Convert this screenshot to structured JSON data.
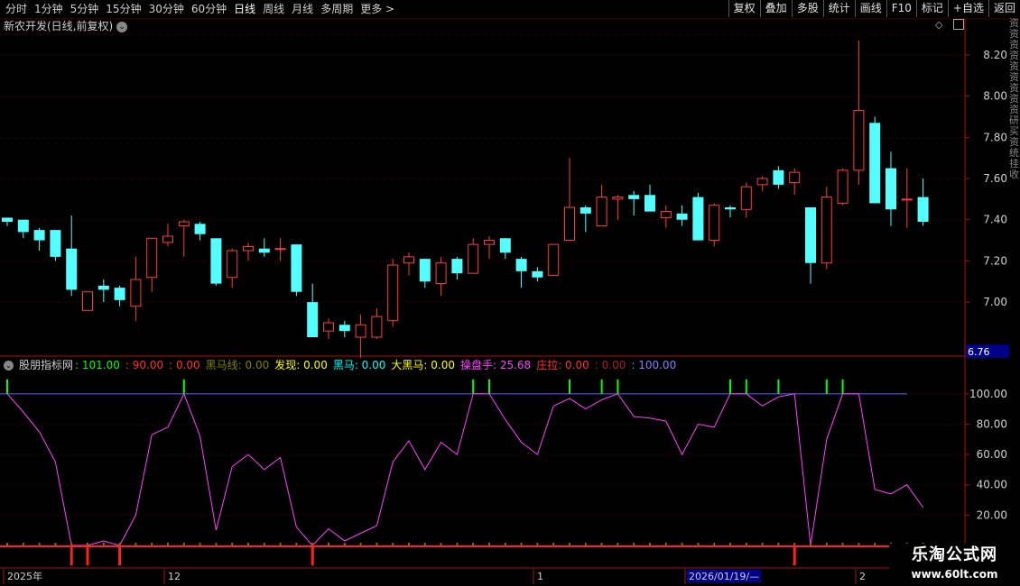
{
  "toolbar": {
    "periods": [
      "分时",
      "1分钟",
      "5分钟",
      "15分钟",
      "30分钟",
      "60分钟",
      "日线",
      "周线",
      "月线",
      "多周期",
      "更多 >"
    ],
    "active_period": "日线",
    "tools": [
      "复权",
      "叠加",
      "多股",
      "统计",
      "画线",
      "F10",
      "标记",
      "+自选",
      "返回"
    ]
  },
  "stock": {
    "title": "新农开发(日线,前复权)"
  },
  "price_axis": {
    "ticks": [
      "8.20",
      "8.00",
      "7.80",
      "7.60",
      "7.40",
      "7.20",
      "7.00"
    ],
    "marker": "6.76"
  },
  "right_strip": {
    "text": "资资资资资资资资资研买资统挂收"
  },
  "indicator": {
    "name": "股朋指标网",
    "items": [
      {
        "label": ": 101.00",
        "color": "#00ff00"
      },
      {
        "label": ": 90.00",
        "color": "#ff3030"
      },
      {
        "label": ": 0.00",
        "color": "#ff3030"
      },
      {
        "label": "黑马线: 0.00",
        "color": "#808000"
      },
      {
        "label": "发现: 0.00",
        "color": "#ffff00"
      },
      {
        "label": "黑马: 0.00",
        "color": "#00ffff"
      },
      {
        "label": "大黑马: 0.00",
        "color": "#ffff00"
      },
      {
        "label": "操盘手: 25.68",
        "color": "#ff40ff"
      },
      {
        "label": "庄拉: 0.00",
        "color": "#ff3030"
      },
      {
        "label": ": 0.00",
        "color": "#aa2020"
      },
      {
        "label": ": 100.00",
        "color": "#8080ff"
      }
    ],
    "ticks": [
      "100.00",
      "80.00",
      "60.00",
      "40.00",
      "20.00"
    ]
  },
  "time_axis": {
    "labels": [
      "2025年",
      "12",
      "1",
      "2026/01/19/—",
      "2"
    ]
  },
  "watermark": {
    "line1": "乐淘公式网",
    "line2": "www.60lt.com"
  },
  "colors": {
    "up": "#ff3c3c",
    "down": "#54ffff",
    "grid": "#5a0000",
    "ref_line": "#6060ff",
    "line": "#ff40ff"
  },
  "chart_data": [
    {
      "type": "candlestick",
      "title": "新农开发(日线,前复权)",
      "ylim": [
        6.76,
        8.3
      ],
      "candles": [
        {
          "o": 7.41,
          "c": 7.39,
          "h": 7.41,
          "l": 7.37
        },
        {
          "o": 7.4,
          "c": 7.34,
          "h": 7.4,
          "l": 7.31
        },
        {
          "o": 7.35,
          "c": 7.3,
          "h": 7.36,
          "l": 7.25
        },
        {
          "o": 7.35,
          "c": 7.22,
          "h": 7.35,
          "l": 7.2
        },
        {
          "o": 7.26,
          "c": 7.06,
          "h": 7.42,
          "l": 7.03
        },
        {
          "o": 6.96,
          "c": 7.05,
          "h": 7.05,
          "l": 6.96
        },
        {
          "o": 7.08,
          "c": 7.06,
          "h": 7.11,
          "l": 7.0
        },
        {
          "o": 7.07,
          "c": 7.01,
          "h": 7.08,
          "l": 6.98
        },
        {
          "o": 6.98,
          "c": 7.11,
          "h": 7.22,
          "l": 6.91
        },
        {
          "o": 7.12,
          "c": 7.31,
          "h": 7.31,
          "l": 7.05
        },
        {
          "o": 7.29,
          "c": 7.32,
          "h": 7.38,
          "l": 7.27
        },
        {
          "o": 7.37,
          "c": 7.39,
          "h": 7.4,
          "l": 7.22
        },
        {
          "o": 7.38,
          "c": 7.33,
          "h": 7.39,
          "l": 7.3
        },
        {
          "o": 7.31,
          "c": 7.09,
          "h": 7.31,
          "l": 7.08
        },
        {
          "o": 7.12,
          "c": 7.25,
          "h": 7.26,
          "l": 7.07
        },
        {
          "o": 7.25,
          "c": 7.27,
          "h": 7.29,
          "l": 7.2
        },
        {
          "o": 7.26,
          "c": 7.24,
          "h": 7.31,
          "l": 7.22
        },
        {
          "o": 7.26,
          "c": 7.26,
          "h": 7.31,
          "l": 7.2
        },
        {
          "o": 7.28,
          "c": 7.05,
          "h": 7.28,
          "l": 7.03
        },
        {
          "o": 7.0,
          "c": 6.83,
          "h": 7.09,
          "l": 6.83
        },
        {
          "o": 6.86,
          "c": 6.9,
          "h": 6.92,
          "l": 6.82
        },
        {
          "o": 6.89,
          "c": 6.86,
          "h": 6.91,
          "l": 6.83
        },
        {
          "o": 6.83,
          "c": 6.89,
          "h": 6.94,
          "l": 6.73
        },
        {
          "o": 6.83,
          "c": 6.93,
          "h": 6.97,
          "l": 6.82
        },
        {
          "o": 6.91,
          "c": 7.18,
          "h": 7.21,
          "l": 6.88
        },
        {
          "o": 7.19,
          "c": 7.22,
          "h": 7.24,
          "l": 7.13
        },
        {
          "o": 7.21,
          "c": 7.1,
          "h": 7.21,
          "l": 7.07
        },
        {
          "o": 7.09,
          "c": 7.19,
          "h": 7.22,
          "l": 7.03
        },
        {
          "o": 7.21,
          "c": 7.14,
          "h": 7.22,
          "l": 7.11
        },
        {
          "o": 7.14,
          "c": 7.28,
          "h": 7.31,
          "l": 7.14
        },
        {
          "o": 7.28,
          "c": 7.3,
          "h": 7.32,
          "l": 7.21
        },
        {
          "o": 7.31,
          "c": 7.24,
          "h": 7.31,
          "l": 7.21
        },
        {
          "o": 7.21,
          "c": 7.15,
          "h": 7.22,
          "l": 7.07
        },
        {
          "o": 7.15,
          "c": 7.12,
          "h": 7.17,
          "l": 7.1
        },
        {
          "o": 7.13,
          "c": 7.28,
          "h": 7.28,
          "l": 7.13
        },
        {
          "o": 7.3,
          "c": 7.46,
          "h": 7.7,
          "l": 7.3
        },
        {
          "o": 7.46,
          "c": 7.43,
          "h": 7.47,
          "l": 7.34
        },
        {
          "o": 7.37,
          "c": 7.51,
          "h": 7.57,
          "l": 7.37
        },
        {
          "o": 7.5,
          "c": 7.51,
          "h": 7.52,
          "l": 7.4
        },
        {
          "o": 7.52,
          "c": 7.5,
          "h": 7.54,
          "l": 7.42
        },
        {
          "o": 7.52,
          "c": 7.44,
          "h": 7.57,
          "l": 7.44
        },
        {
          "o": 7.41,
          "c": 7.44,
          "h": 7.47,
          "l": 7.36
        },
        {
          "o": 7.43,
          "c": 7.4,
          "h": 7.47,
          "l": 7.37
        },
        {
          "o": 7.51,
          "c": 7.3,
          "h": 7.53,
          "l": 7.3
        },
        {
          "o": 7.3,
          "c": 7.47,
          "h": 7.48,
          "l": 7.27
        },
        {
          "o": 7.46,
          "c": 7.45,
          "h": 7.47,
          "l": 7.41
        },
        {
          "o": 7.45,
          "c": 7.56,
          "h": 7.58,
          "l": 7.41
        },
        {
          "o": 7.57,
          "c": 7.6,
          "h": 7.61,
          "l": 7.54
        },
        {
          "o": 7.64,
          "c": 7.57,
          "h": 7.66,
          "l": 7.55
        },
        {
          "o": 7.58,
          "c": 7.63,
          "h": 7.65,
          "l": 7.52
        },
        {
          "o": 7.46,
          "c": 7.19,
          "h": 7.46,
          "l": 7.09
        },
        {
          "o": 7.19,
          "c": 7.51,
          "h": 7.56,
          "l": 7.16
        },
        {
          "o": 7.48,
          "c": 7.64,
          "h": 7.65,
          "l": 7.47
        },
        {
          "o": 7.64,
          "c": 7.93,
          "h": 8.27,
          "l": 7.57
        },
        {
          "o": 7.87,
          "c": 7.48,
          "h": 7.9,
          "l": 7.48
        },
        {
          "o": 7.65,
          "c": 7.45,
          "h": 7.73,
          "l": 7.37
        },
        {
          "o": 7.5,
          "c": 7.5,
          "h": 7.65,
          "l": 7.36
        },
        {
          "o": 7.51,
          "c": 7.39,
          "h": 7.6,
          "l": 7.37
        }
      ]
    },
    {
      "type": "line",
      "title": "股朋指标网",
      "ylim": [
        0,
        110
      ],
      "values": [
        100,
        88,
        75,
        55,
        0,
        0,
        3,
        0,
        20,
        73,
        78,
        100,
        72,
        10,
        52,
        60,
        50,
        58,
        12,
        0,
        11,
        3,
        8,
        13,
        55,
        69,
        50,
        68,
        60,
        100,
        100,
        83,
        68,
        60,
        92,
        97,
        90,
        96,
        100,
        85,
        84,
        82,
        60,
        80,
        78,
        100,
        100,
        92,
        98,
        100,
        0,
        70,
        100,
        100,
        37,
        34,
        40,
        25
      ],
      "ref_line": 100,
      "top_markers": [
        0,
        11,
        29,
        30,
        35,
        37,
        38,
        45,
        46,
        48,
        51,
        52
      ],
      "bottom_markers": [
        4,
        5,
        7,
        19,
        49
      ]
    }
  ]
}
